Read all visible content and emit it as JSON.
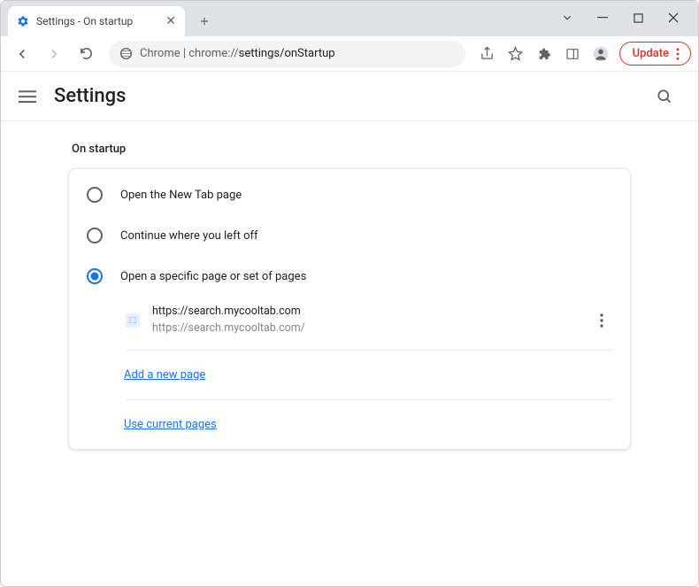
{
  "window": {
    "tab_title": "Settings - On startup"
  },
  "omnibox": {
    "prefix": "Chrome",
    "separator": " | ",
    "path_grey": "chrome://",
    "path_dark": "settings/onStartup"
  },
  "toolbar": {
    "update_label": "Update"
  },
  "header": {
    "title": "Settings"
  },
  "section": {
    "title": "On startup"
  },
  "radios": [
    {
      "label": "Open the New Tab page",
      "selected": false
    },
    {
      "label": "Continue where you left off",
      "selected": false
    },
    {
      "label": "Open a specific page or set of pages",
      "selected": true
    }
  ],
  "page_entry": {
    "title": "https://search.mycooltab.com",
    "url": "https://search.mycooltab.com/"
  },
  "links": {
    "add_page": "Add a new page",
    "use_current": "Use current pages"
  }
}
